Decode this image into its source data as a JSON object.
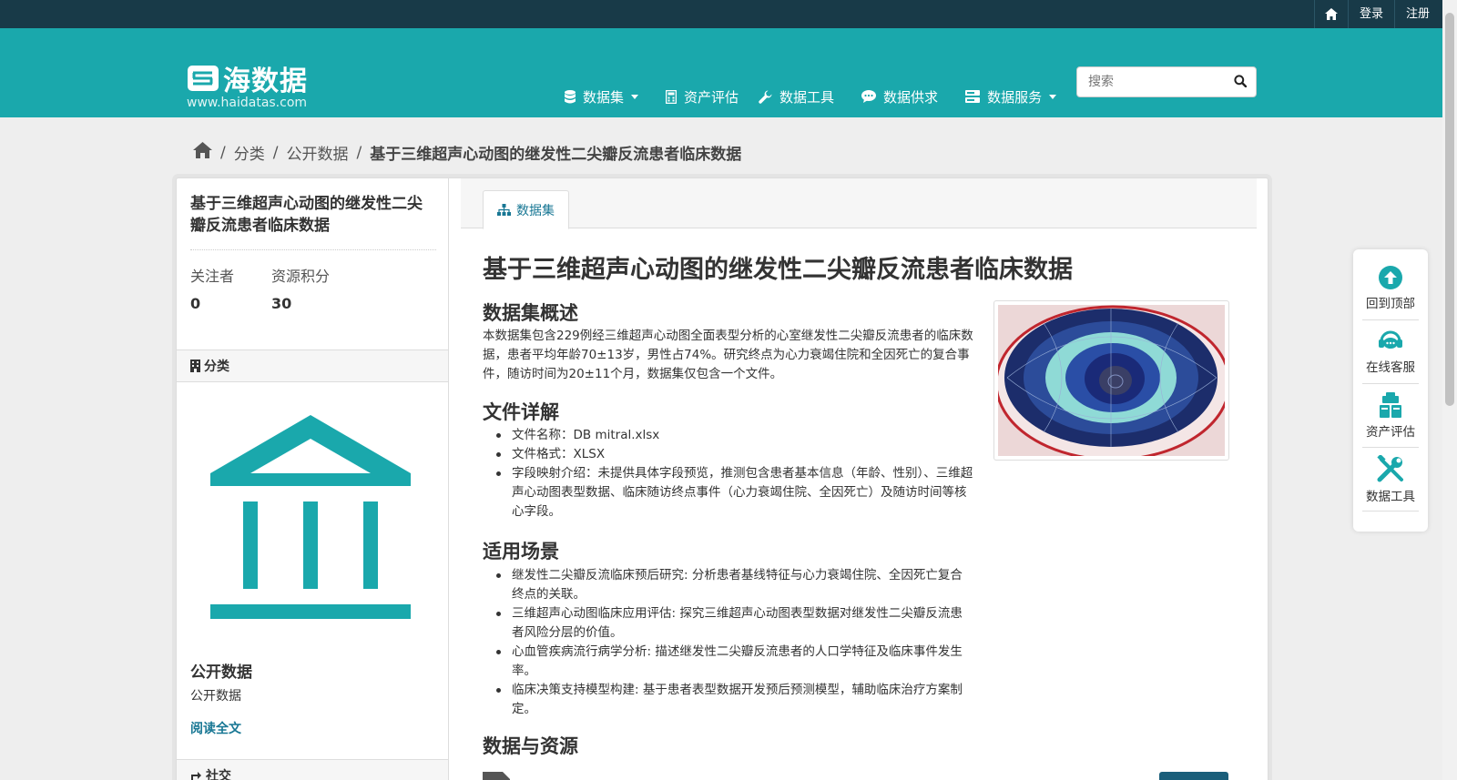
{
  "topbar": {
    "home_icon": "home-icon",
    "login": "登录",
    "register": "注册"
  },
  "header": {
    "logo_text": "海数据",
    "site_url": "www.haidatas.com",
    "nav": [
      {
        "label": "数据集",
        "icon": "database-icon",
        "dropdown": true
      },
      {
        "label": "资产评估",
        "icon": "calculator-icon",
        "dropdown": false
      },
      {
        "label": "数据工具",
        "icon": "wrench-icon",
        "dropdown": false
      },
      {
        "label": "数据供求",
        "icon": "chat-icon",
        "dropdown": false
      },
      {
        "label": "数据服务",
        "icon": "server-icon",
        "dropdown": true
      }
    ],
    "search_placeholder": "搜索"
  },
  "breadcrumb": {
    "home_icon": "home-icon",
    "items": [
      "分类",
      "公开数据",
      "基于三维超声心动图的继发性二尖瓣反流患者临床数据"
    ]
  },
  "sidebar": {
    "title": "基于三维超声心动图的继发性二尖瓣反流患者临床数据",
    "followers_label": "关注者",
    "followers_value": "0",
    "points_label": "资源积分",
    "points_value": "30",
    "category_head": "分类",
    "org_name": "公开数据",
    "org_desc": "公开数据",
    "read_more": "阅读全文",
    "social_head": "社交"
  },
  "main": {
    "tab_label": "数据集",
    "title": "基于三维超声心动图的继发性二尖瓣反流患者临床数据",
    "overview_heading": "数据集概述",
    "overview_text": "本数据集包含229例经三维超声心动图全面表型分析的心室继发性二尖瓣反流患者的临床数据，患者平均年龄70±13岁，男性占74%。研究终点为心力衰竭住院和全因死亡的复合事件，随访时间为20±11个月，数据集仅包含一个文件。",
    "files_heading": "文件详解",
    "files": [
      "文件名称：DB mitral.xlsx",
      "文件格式：XLSX",
      "字段映射介绍：未提供具体字段预览，推测包含患者基本信息（年龄、性别）、三维超声心动图表型数据、临床随访终点事件（心力衰竭住院、全因死亡）及随访时间等核心字段。"
    ],
    "usage_heading": "适用场景",
    "usage": [
      "继发性二尖瓣反流临床预后研究: 分析患者基线特征与心力衰竭住院、全因死亡复合终点的关联。",
      "三维超声心动图临床应用评估: 探究三维超声心动图表型数据对继发性二尖瓣反流患者风险分层的价值。",
      "心血管疾病流行病学分析: 描述继发性二尖瓣反流患者的人口学特征及临床事件发生率。",
      "临床决策支持模型构建: 基于患者表型数据开发预后预测模型，辅助临床治疗方案制定。"
    ],
    "resources_heading": "数据与资源"
  },
  "float_toolbar": [
    {
      "label": "回到顶部",
      "icon": "arrow-up-circle-icon"
    },
    {
      "label": "在线客服",
      "icon": "headset-icon"
    },
    {
      "label": "资产评估",
      "icon": "clipboard-icon"
    },
    {
      "label": "数据工具",
      "icon": "tools-icon"
    }
  ],
  "colors": {
    "topbar": "#183a48",
    "masthead": "#1aa8ac",
    "accent": "#1aa8ac",
    "link": "#187794"
  }
}
